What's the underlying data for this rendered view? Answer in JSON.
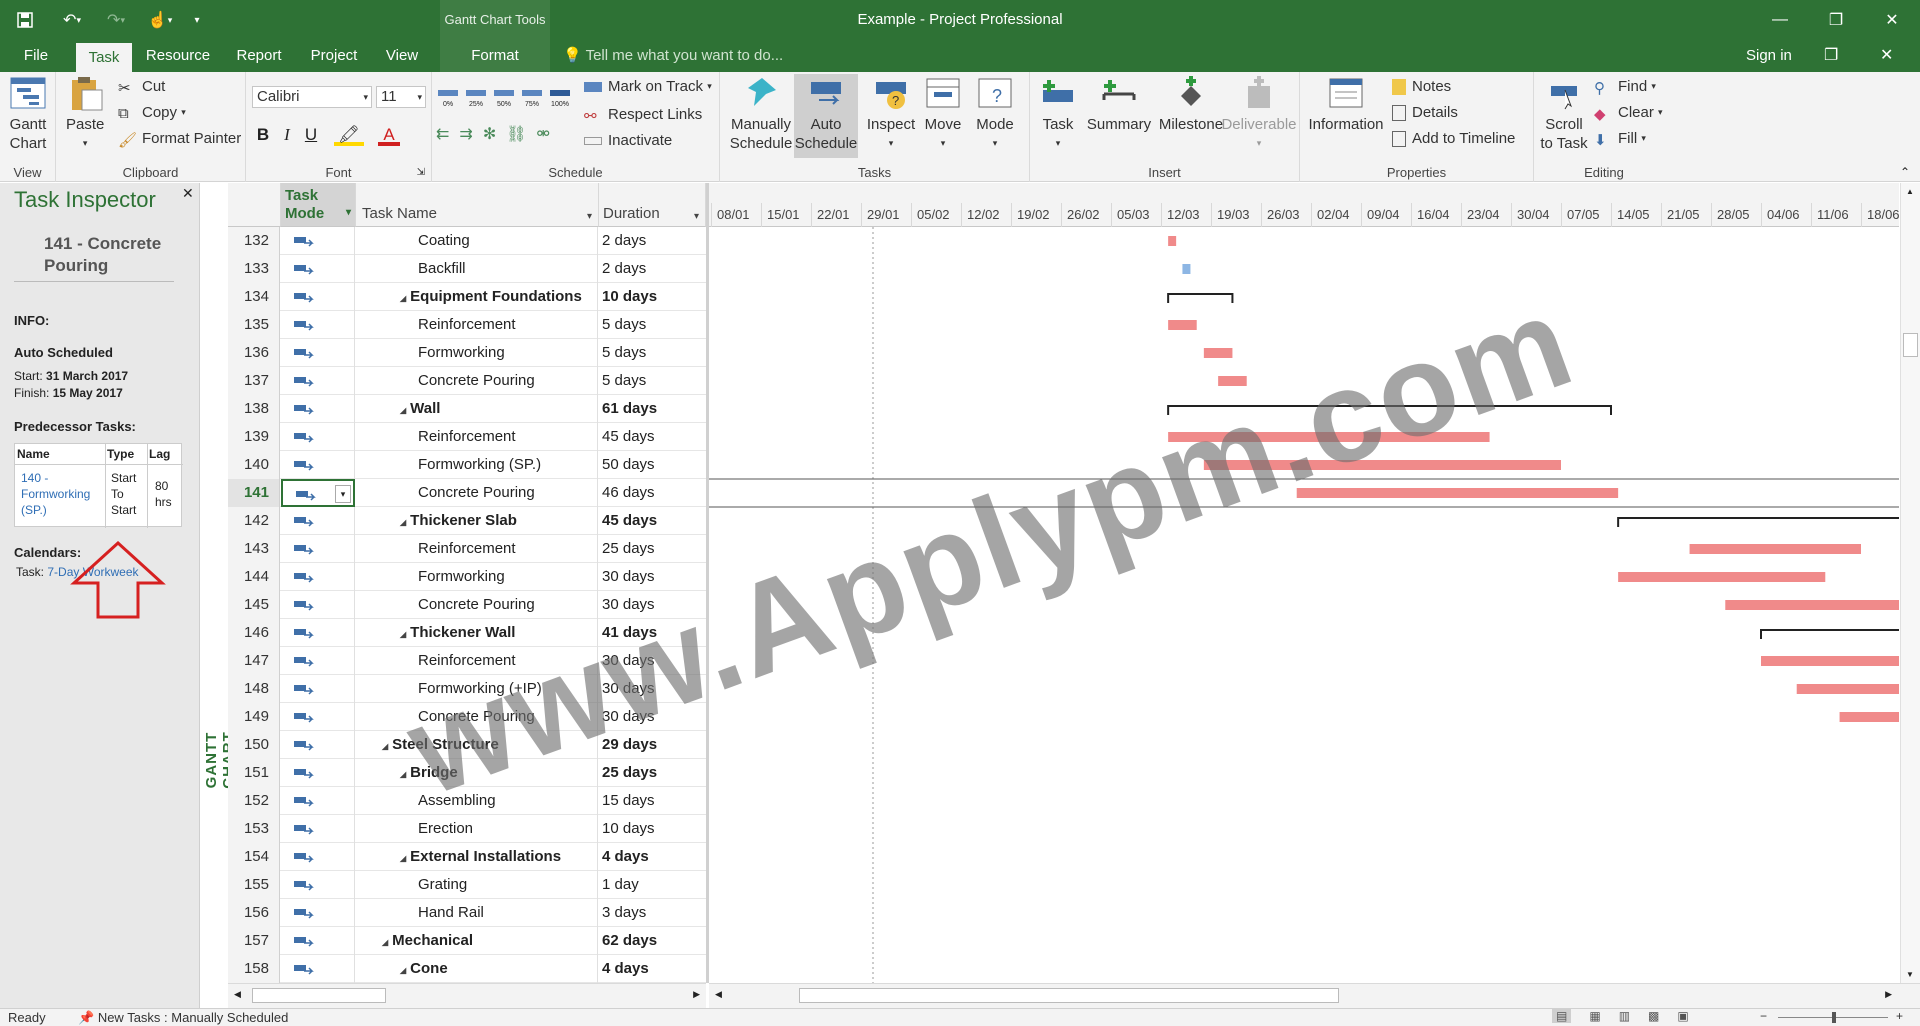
{
  "window": {
    "title": "Example - Project Professional",
    "context_tools": "Gantt Chart Tools",
    "sign_in": "Sign in",
    "tell_me": "Tell me what you want to do..."
  },
  "tabs": [
    "File",
    "Task",
    "Resource",
    "Report",
    "Project",
    "View",
    "Format"
  ],
  "ribbon": {
    "view": {
      "gantt_chart": "Gantt Chart",
      "label": "View"
    },
    "clipboard": {
      "paste": "Paste",
      "cut": "Cut",
      "copy": "Copy",
      "format_painter": "Format Painter",
      "label": "Clipboard"
    },
    "font": {
      "family": "Calibri",
      "size": "11",
      "label": "Font"
    },
    "schedule": {
      "mark_on_track": "Mark on Track",
      "respect_links": "Respect Links",
      "inactivate": "Inactivate",
      "label": "Schedule",
      "pct": [
        "0%",
        "25%",
        "50%",
        "75%",
        "100%"
      ]
    },
    "tasks": {
      "manually": "Manually Schedule",
      "auto": "Auto Schedule",
      "inspect": "Inspect",
      "move": "Move",
      "mode": "Mode",
      "label": "Tasks"
    },
    "insert": {
      "task": "Task",
      "summary": "Summary",
      "milestone": "Milestone",
      "deliverable": "Deliverable",
      "label": "Insert"
    },
    "properties": {
      "information": "Information",
      "notes": "Notes",
      "details": "Details",
      "add_to_timeline": "Add to Timeline",
      "label": "Properties"
    },
    "editing": {
      "scroll_to_task": "Scroll to Task",
      "find": "Find",
      "clear": "Clear",
      "fill": "Fill",
      "label": "Editing"
    }
  },
  "inspector": {
    "title": "Task Inspector",
    "task_name": "141 - Concrete Pouring",
    "info_label": "INFO:",
    "schedule_mode": "Auto Scheduled",
    "start_label": "Start:",
    "start": "31 March 2017",
    "finish_label": "Finish:",
    "finish": "15 May 2017",
    "pred_label": "Predecessor Tasks:",
    "pred_headers": [
      "Name",
      "Type",
      "Lag"
    ],
    "pred_name": "140 - Formworking (SP.)",
    "pred_type": "Start To Start",
    "pred_lag": "80 hrs",
    "calendars_label": "Calendars:",
    "calendar_task_label": "Task:",
    "calendar_task": "7-Day Workweek"
  },
  "view_label": "GANTT CHART",
  "grid": {
    "headers": {
      "mode": "Task Mode",
      "name": "Task Name",
      "duration": "Duration"
    },
    "rows": [
      {
        "id": "132",
        "name": "Coating",
        "dur": "2 days",
        "indent": 3,
        "summary": false
      },
      {
        "id": "133",
        "name": "Backfill",
        "dur": "2 days",
        "indent": 3,
        "summary": false
      },
      {
        "id": "134",
        "name": "Equipment Foundations",
        "dur": "10 days",
        "indent": 2,
        "summary": true
      },
      {
        "id": "135",
        "name": "Reinforcement",
        "dur": "5 days",
        "indent": 3,
        "summary": false
      },
      {
        "id": "136",
        "name": "Formworking",
        "dur": "5 days",
        "indent": 3,
        "summary": false
      },
      {
        "id": "137",
        "name": "Concrete Pouring",
        "dur": "5 days",
        "indent": 3,
        "summary": false
      },
      {
        "id": "138",
        "name": "Wall",
        "dur": "61 days",
        "indent": 2,
        "summary": true
      },
      {
        "id": "139",
        "name": "Reinforcement",
        "dur": "45 days",
        "indent": 3,
        "summary": false
      },
      {
        "id": "140",
        "name": "Formworking (SP.)",
        "dur": "50 days",
        "indent": 3,
        "summary": false
      },
      {
        "id": "141",
        "name": "Concrete Pouring",
        "dur": "46 days",
        "indent": 3,
        "summary": false,
        "selected": true
      },
      {
        "id": "142",
        "name": "Thickener Slab",
        "dur": "45 days",
        "indent": 2,
        "summary": true
      },
      {
        "id": "143",
        "name": "Reinforcement",
        "dur": "25 days",
        "indent": 3,
        "summary": false
      },
      {
        "id": "144",
        "name": "Formworking",
        "dur": "30 days",
        "indent": 3,
        "summary": false
      },
      {
        "id": "145",
        "name": "Concrete Pouring",
        "dur": "30 days",
        "indent": 3,
        "summary": false
      },
      {
        "id": "146",
        "name": "Thickener Wall",
        "dur": "41 days",
        "indent": 2,
        "summary": true
      },
      {
        "id": "147",
        "name": "Reinforcement",
        "dur": "30 days",
        "indent": 3,
        "summary": false
      },
      {
        "id": "148",
        "name": "Formworking (+IP)",
        "dur": "30 days",
        "indent": 3,
        "summary": false
      },
      {
        "id": "149",
        "name": "Concrete Pouring",
        "dur": "30 days",
        "indent": 3,
        "summary": false
      },
      {
        "id": "150",
        "name": "Steel Structure",
        "dur": "29 days",
        "indent": 1,
        "summary": true
      },
      {
        "id": "151",
        "name": "Bridge",
        "dur": "25 days",
        "indent": 2,
        "summary": true
      },
      {
        "id": "152",
        "name": "Assembling",
        "dur": "15 days",
        "indent": 3,
        "summary": false
      },
      {
        "id": "153",
        "name": "Erection",
        "dur": "10 days",
        "indent": 3,
        "summary": false
      },
      {
        "id": "154",
        "name": "External Installations",
        "dur": "4 days",
        "indent": 2,
        "summary": true
      },
      {
        "id": "155",
        "name": "Grating",
        "dur": "1 day",
        "indent": 3,
        "summary": false
      },
      {
        "id": "156",
        "name": "Hand Rail",
        "dur": "3 days",
        "indent": 3,
        "summary": false
      },
      {
        "id": "157",
        "name": "Mechanical",
        "dur": "62 days",
        "indent": 1,
        "summary": true
      },
      {
        "id": "158",
        "name": "Cone",
        "dur": "4 days",
        "indent": 2,
        "summary": true
      }
    ]
  },
  "timescale": [
    "08/01",
    "15/01",
    "22/01",
    "29/01",
    "05/02",
    "12/02",
    "19/02",
    "26/02",
    "05/03",
    "12/03",
    "19/03",
    "26/03",
    "02/04",
    "09/04",
    "16/04",
    "23/04",
    "30/04",
    "07/05",
    "14/05",
    "21/05",
    "28/05",
    "04/06",
    "11/06",
    "18/06"
  ],
  "gantt": {
    "timescale_start": "08/01",
    "bar_color": "#f08a8a",
    "manual_color": "#8db6e4",
    "tasks": [
      {
        "row": 0,
        "start": "13/03",
        "end": "14/03",
        "type": "bar"
      },
      {
        "row": 1,
        "start": "15/03",
        "end": "16/03",
        "type": "manual"
      },
      {
        "row": 2,
        "start": "13/03",
        "end": "22/03",
        "type": "summary"
      },
      {
        "row": 3,
        "start": "13/03",
        "end": "17/03",
        "type": "bar"
      },
      {
        "row": 4,
        "start": "18/03",
        "end": "22/03",
        "type": "bar"
      },
      {
        "row": 5,
        "start": "20/03",
        "end": "24/03",
        "type": "bar"
      },
      {
        "row": 6,
        "start": "13/03",
        "end": "14/05",
        "type": "summary"
      },
      {
        "row": 7,
        "start": "13/03",
        "end": "27/04",
        "type": "bar"
      },
      {
        "row": 8,
        "start": "18/03",
        "end": "07/05",
        "type": "bar"
      },
      {
        "row": 9,
        "start": "31/03",
        "end": "15/05",
        "type": "bar"
      },
      {
        "row": 10,
        "start": "15/05",
        "end": "29/06",
        "type": "summary"
      },
      {
        "row": 11,
        "start": "25/05",
        "end": "18/06",
        "type": "bar"
      },
      {
        "row": 12,
        "start": "15/05",
        "end": "13/06",
        "type": "bar"
      },
      {
        "row": 13,
        "start": "30/05",
        "end": "29/06",
        "type": "bar"
      },
      {
        "row": 14,
        "start": "04/06",
        "end": "29/06",
        "type": "summary"
      },
      {
        "row": 15,
        "start": "04/06",
        "end": "29/06",
        "type": "bar"
      },
      {
        "row": 16,
        "start": "09/06",
        "end": "29/06",
        "type": "bar"
      },
      {
        "row": 17,
        "start": "15/06",
        "end": "29/06",
        "type": "bar"
      }
    ]
  },
  "watermark": "www.Applypm.com",
  "status": {
    "ready": "Ready",
    "new_tasks": "New Tasks : Manually Scheduled"
  }
}
